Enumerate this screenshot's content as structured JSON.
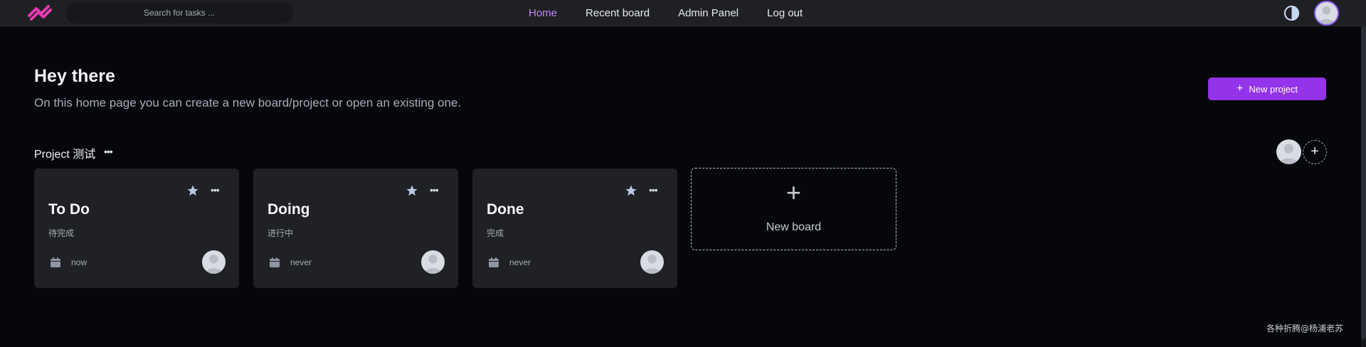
{
  "header": {
    "search_placeholder": "Search for tasks ...",
    "nav": [
      {
        "label": "Home",
        "active": true
      },
      {
        "label": "Recent board",
        "active": false
      },
      {
        "label": "Admin Panel",
        "active": false
      },
      {
        "label": "Log out",
        "active": false
      }
    ],
    "logo_icon": "app-logo-icon",
    "theme_icon": "half-circle-theme-icon",
    "accent_color": "#c084fc"
  },
  "hero": {
    "title": "Hey there",
    "subtitle": "On this home page you can create a new board/project or open an existing one.",
    "new_project_label": "New project",
    "button_color": "#9333ea"
  },
  "project": {
    "title": "Project 测试",
    "boards": [
      {
        "name": "To Do",
        "description": "待完成",
        "due": "now"
      },
      {
        "name": "Doing",
        "description": "进行中",
        "due": "never"
      },
      {
        "name": "Done",
        "description": "完成",
        "due": "never"
      }
    ],
    "new_board_label": "New board"
  },
  "footer": {
    "watermark": "各种折腾@杨浦老苏"
  }
}
